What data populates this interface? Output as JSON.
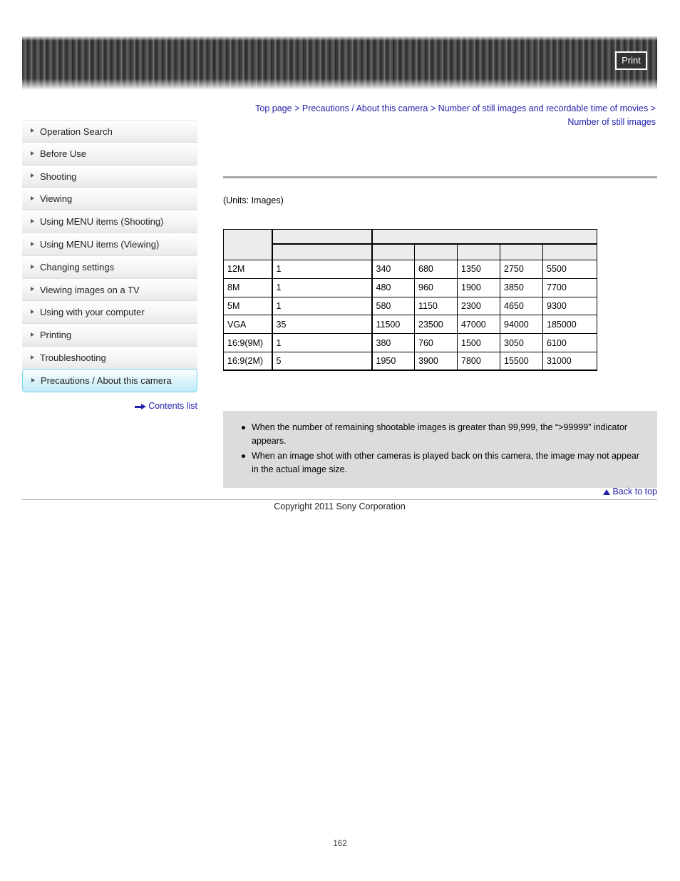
{
  "header": {
    "print_label": "Print"
  },
  "breadcrumb": {
    "items": [
      {
        "label": "Top page"
      },
      {
        "label": "Precautions / About this camera"
      },
      {
        "label": "Number of still images and recordable time of movies"
      },
      {
        "label": "Number of still images"
      }
    ],
    "separator": ">"
  },
  "sidebar": {
    "items": [
      {
        "label": "Operation Search",
        "selected": false
      },
      {
        "label": "Before Use",
        "selected": false
      },
      {
        "label": "Shooting",
        "selected": false
      },
      {
        "label": "Viewing",
        "selected": false
      },
      {
        "label": "Using MENU items (Shooting)",
        "selected": false
      },
      {
        "label": "Using MENU items (Viewing)",
        "selected": false
      },
      {
        "label": "Changing settings",
        "selected": false
      },
      {
        "label": "Viewing images on a TV",
        "selected": false
      },
      {
        "label": "Using with your computer",
        "selected": false
      },
      {
        "label": "Printing",
        "selected": false
      },
      {
        "label": "Troubleshooting",
        "selected": false
      },
      {
        "label": "Precautions / About this camera",
        "selected": true
      }
    ],
    "contents_list_label": "Contents list"
  },
  "main": {
    "units_label": "(Units: Images)",
    "table": {
      "header_row_1": [
        "",
        "",
        ""
      ],
      "header_row_2": [
        "",
        "",
        "",
        "",
        "",
        ""
      ],
      "rows": [
        {
          "size": "12M",
          "internal": "1",
          "cards": [
            "340",
            "680",
            "1350",
            "2750",
            "5500"
          ]
        },
        {
          "size": "8M",
          "internal": "1",
          "cards": [
            "480",
            "960",
            "1900",
            "3850",
            "7700"
          ]
        },
        {
          "size": "5M",
          "internal": "1",
          "cards": [
            "580",
            "1150",
            "2300",
            "4650",
            "9300"
          ]
        },
        {
          "size": "VGA",
          "internal": "35",
          "cards": [
            "11500",
            "23500",
            "47000",
            "94000",
            "185000"
          ]
        },
        {
          "size": "16:9(9M)",
          "internal": "1",
          "cards": [
            "380",
            "760",
            "1500",
            "3050",
            "6100"
          ]
        },
        {
          "size": "16:9(2M)",
          "internal": "5",
          "cards": [
            "1950",
            "3900",
            "7800",
            "15500",
            "31000"
          ]
        }
      ]
    },
    "notes": [
      "When the number of remaining shootable images is greater than 99,999, the “>99999” indicator appears.",
      "When an image shot with other cameras is played back on this camera, the image may not appear in the actual image size."
    ]
  },
  "footer": {
    "back_to_top_label": "Back to top",
    "copyright": "Copyright 2011 Sony Corporation",
    "page_number": "162"
  },
  "colors": {
    "link": "#2222aa",
    "selected_border": "#6fd5ef",
    "notes_bg": "#dcdcdc",
    "table_header_bg": "#ececec",
    "rule": "#a9a9a9"
  }
}
